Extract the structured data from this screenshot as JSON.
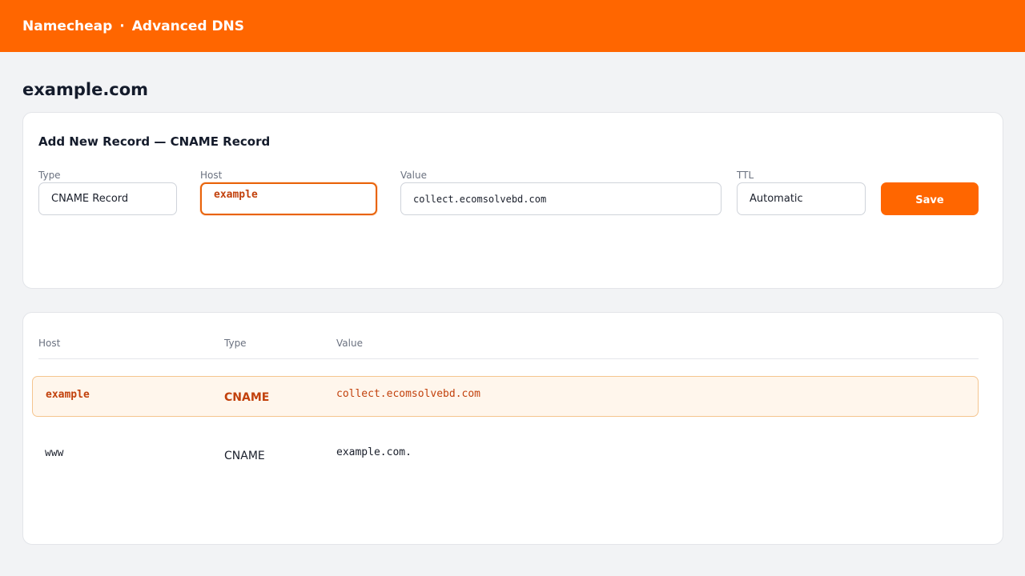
{
  "header": {
    "brand": "Namecheap",
    "separator": "·",
    "section": "Advanced DNS"
  },
  "page": {
    "domain": "example.com"
  },
  "form": {
    "title": "Add New Record — CNAME Record",
    "type_label": "Type",
    "type_value": "CNAME Record",
    "host_label": "Host",
    "host_value": "example",
    "value_label": "Value",
    "value_value": "collect.ecomsolvebd.com",
    "ttl_label": "TTL",
    "ttl_value": "Automatic",
    "save_label": "Save"
  },
  "table": {
    "columns": [
      "Host",
      "Type",
      "Value"
    ],
    "rows": [
      {
        "host": "example",
        "type": "CNAME",
        "value": "collect.ecomsolvebd.com",
        "highlighted": true
      },
      {
        "host": "www",
        "type": "CNAME",
        "value": "example.com.",
        "highlighted": false
      }
    ]
  },
  "colors": {
    "brand": "#ff6600",
    "highlight_text": "#c2410c",
    "highlight_bg": "#fff6ec"
  }
}
